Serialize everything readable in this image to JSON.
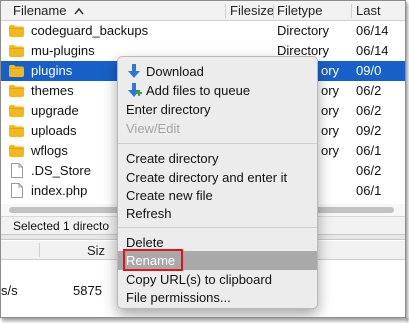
{
  "columns": {
    "filename": "Filename",
    "sort_indicator": "^",
    "filesize": "Filesize",
    "filetype": "Filetype",
    "last": "Last"
  },
  "files": [
    {
      "name": "codeguard_backups",
      "size": "",
      "type": "Directory",
      "date": "06/14",
      "icon": "folder-icon",
      "selected": false
    },
    {
      "name": "mu-plugins",
      "size": "",
      "type": "Directory",
      "date": "06/14",
      "icon": "folder-icon",
      "selected": false
    },
    {
      "name": "plugins",
      "size": "",
      "type": "ory",
      "date": "09/0",
      "icon": "folder-icon",
      "selected": true
    },
    {
      "name": "themes",
      "size": "",
      "type": "ory",
      "date": "06/2",
      "icon": "folder-icon",
      "selected": false
    },
    {
      "name": "upgrade",
      "size": "",
      "type": "ory",
      "date": "06/2",
      "icon": "folder-icon",
      "selected": false
    },
    {
      "name": "uploads",
      "size": "",
      "type": "ory",
      "date": "09/2",
      "icon": "folder-icon",
      "selected": false
    },
    {
      "name": "wflogs",
      "size": "",
      "type": "ory",
      "date": "06/1",
      "icon": "folder-icon",
      "selected": false
    },
    {
      "name": ".DS_Store",
      "size": "",
      "type": "",
      "date": "06/2",
      "icon": "file-icon",
      "selected": false
    },
    {
      "name": "index.php",
      "size": "",
      "type": "",
      "date": "06/1",
      "icon": "file-icon",
      "selected": false
    }
  ],
  "status": "Selected 1 directo",
  "queue": {
    "size_header": "Siz",
    "row_speed": "s/s",
    "row_value": "5875"
  },
  "menu": {
    "download": "Download",
    "add_to_queue": "Add files to queue",
    "enter_directory": "Enter directory",
    "view_edit": "View/Edit",
    "create_directory": "Create directory",
    "create_directory_enter": "Create directory and enter it",
    "create_new_file": "Create new file",
    "refresh": "Refresh",
    "delete": "Delete",
    "rename": "Rename",
    "copy_url": "Copy URL(s) to clipboard",
    "file_permissions": "File permissions..."
  },
  "colors": {
    "selection": "#1860c9",
    "folder": "#f3b81a",
    "highlight_box": "#e3131a",
    "menu_highlight": "#a9a9a9",
    "download_arrow": "#2f78d8",
    "add_plus": "#3aa23a"
  }
}
